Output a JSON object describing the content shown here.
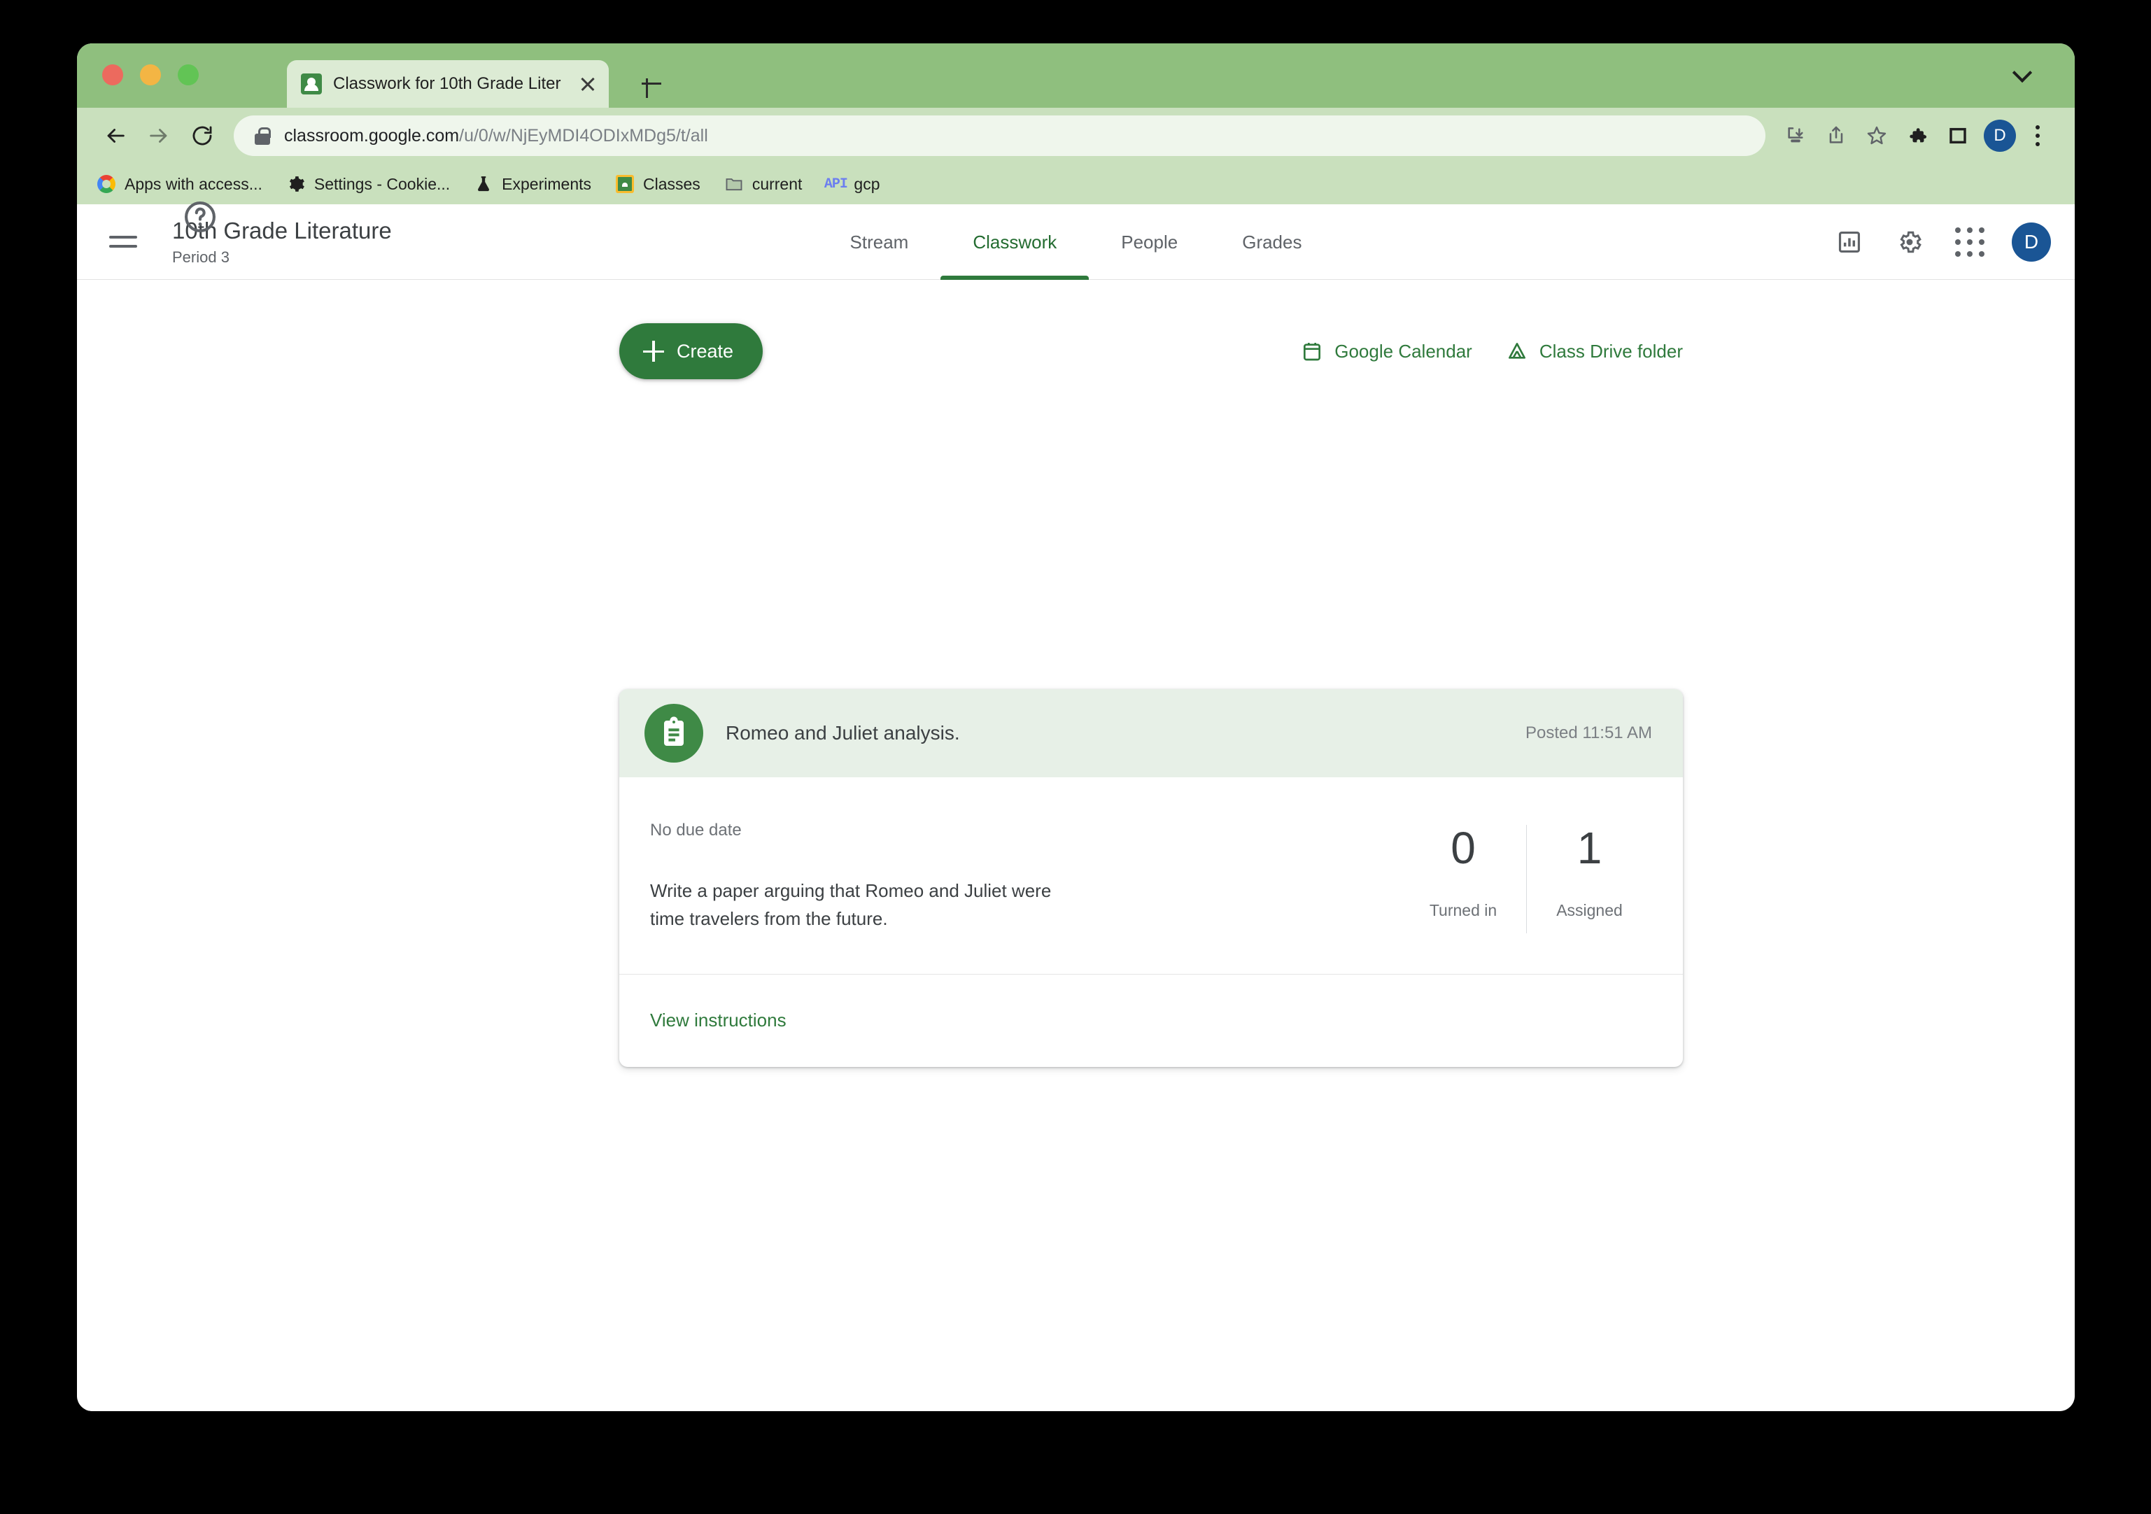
{
  "browser": {
    "tab": {
      "title": "Classwork for 10th Grade Liter",
      "favicon": "google-classroom-icon",
      "close_label": "×"
    },
    "new_tab_label": "+",
    "omnibox": {
      "lock": "lock-icon",
      "url_domain": "classroom.google.com",
      "url_path": "/u/0/w/NjEyMDI4ODIxMDg5/t/all"
    },
    "toolbar_icons": [
      "install-icon",
      "share-icon",
      "bookmark-star-icon",
      "extensions-puzzle-icon",
      "side-panel-icon"
    ],
    "profile_initial": "D",
    "bookmarks": [
      {
        "label": "Apps with access...",
        "icon": "google-g-icon"
      },
      {
        "label": "Settings - Cookie...",
        "icon": "gear-icon"
      },
      {
        "label": "Experiments",
        "icon": "flask-icon"
      },
      {
        "label": "Classes",
        "icon": "google-classroom-icon"
      },
      {
        "label": "current",
        "icon": "folder-icon"
      },
      {
        "label": "gcp",
        "icon": "api-icon"
      }
    ]
  },
  "app": {
    "class_name": "10th Grade Literature",
    "class_section": "Period 3",
    "tabs": [
      {
        "label": "Stream",
        "active": false
      },
      {
        "label": "Classwork",
        "active": true
      },
      {
        "label": "People",
        "active": false
      },
      {
        "label": "Grades",
        "active": false
      }
    ],
    "header_icons": [
      "class-insights-icon",
      "gear-icon",
      "apps-grid-icon"
    ],
    "profile_initial": "D"
  },
  "actions": {
    "create_label": "Create",
    "google_calendar_label": "Google Calendar",
    "class_drive_label": "Class Drive folder"
  },
  "assignment": {
    "icon": "assignment-clipboard-icon",
    "title": "Romeo and Juliet analysis.",
    "posted": "Posted 11:51 AM",
    "due": "No due date",
    "description": "Write a paper arguing that Romeo and Juliet were time travelers from the future.",
    "turned_in_count": "0",
    "turned_in_label": "Turned in",
    "assigned_count": "1",
    "assigned_label": "Assigned",
    "view_instructions_label": "View instructions"
  },
  "help": {
    "icon": "help-circle-icon"
  },
  "colors": {
    "accent_green": "#2f7a3c",
    "chrome_tabstrip": "#8fbf7e",
    "chrome_toolbar": "#c9e0bd",
    "card_header": "#e7f0e7",
    "avatar_blue": "#1a5595"
  }
}
